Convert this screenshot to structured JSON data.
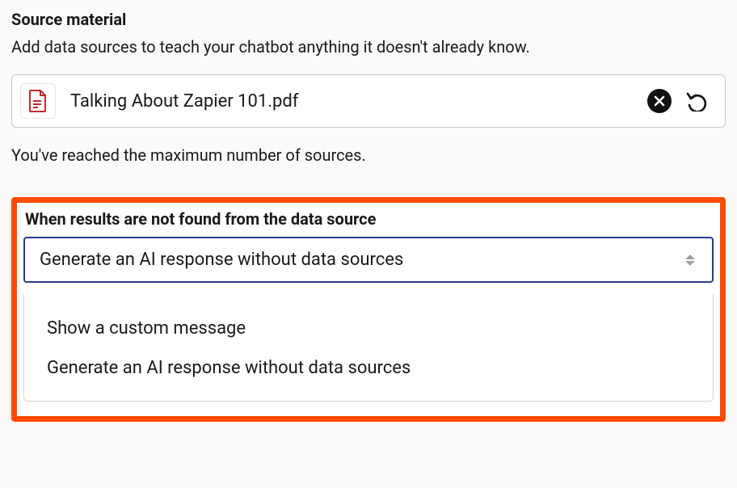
{
  "source_material": {
    "title": "Source material",
    "description": "Add data sources to teach your chatbot anything it doesn't already know.",
    "file": {
      "name": "Talking About Zapier 101.pdf",
      "icon": "pdf-file-icon"
    },
    "max_msg": "You've reached the maximum number of sources."
  },
  "fallback": {
    "label": "When results are not found from the data source",
    "selected": "Generate an AI response without data sources",
    "options": [
      "Show a custom message",
      "Generate an AI response without data sources"
    ]
  }
}
